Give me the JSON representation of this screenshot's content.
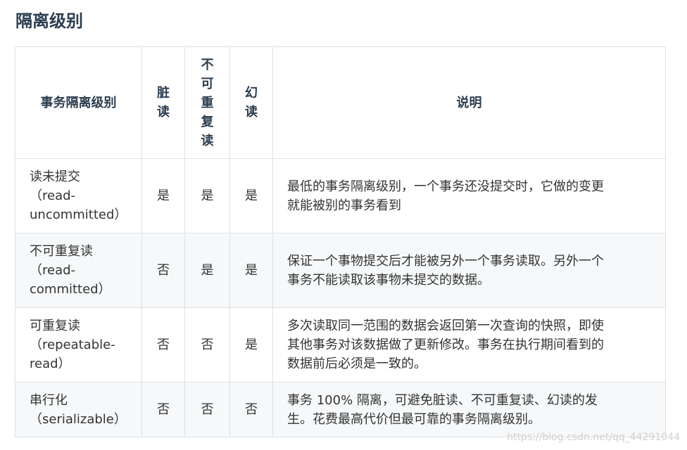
{
  "title": "隔离级别",
  "headers": {
    "level": "事务隔离级别",
    "dirty": [
      "脏",
      "读"
    ],
    "nonrepeatable": [
      "不",
      "可",
      "重",
      "复",
      "读"
    ],
    "phantom": [
      "幻",
      "读"
    ],
    "desc": "说明"
  },
  "rows": [
    {
      "level": [
        "读未提交",
        "（read-",
        "uncommitted）"
      ],
      "dirty": "是",
      "nonrepeatable": "是",
      "phantom": "是",
      "desc": [
        "最低的事务隔离级别，一个事务还没提交时，它做的变更",
        "就能被别的事务看到"
      ]
    },
    {
      "level": [
        "不可重复读",
        "（read-",
        "committed）"
      ],
      "dirty": "否",
      "nonrepeatable": "是",
      "phantom": "是",
      "desc": [
        "保证一个事物提交后才能被另外一个事务读取。另外一个",
        "事务不能读取该事物未提交的数据。"
      ]
    },
    {
      "level": [
        "可重复读",
        "（repeatable-",
        "read）"
      ],
      "dirty": "否",
      "nonrepeatable": "否",
      "phantom": "是",
      "desc": [
        "多次读取同一范围的数据会返回第一次查询的快照，即使",
        "其他事务对该数据做了更新修改。事务在执行期间看到的",
        "数据前后必须是一致的。"
      ]
    },
    {
      "level": [
        "串行化",
        "（serializable）"
      ],
      "dirty": "否",
      "nonrepeatable": "否",
      "phantom": "否",
      "desc": [
        "事务 100% 隔离，可避免脏读、不可重复读、幻读的发",
        "生。花费最高代价但最可靠的事务隔离级别。"
      ]
    }
  ],
  "watermark": "https://blog.csdn.net/qq_44291044"
}
